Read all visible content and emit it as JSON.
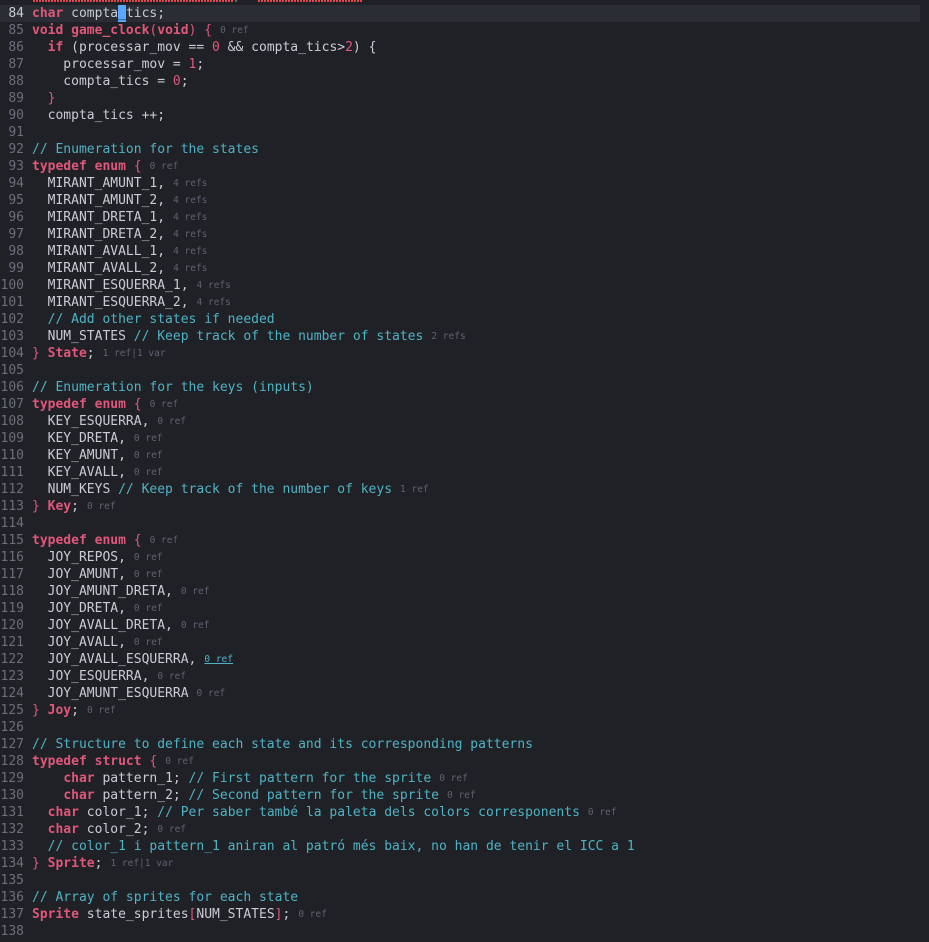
{
  "editor": {
    "lines": [
      {
        "n": "84",
        "tokens": [
          [
            "kw",
            "char"
          ],
          [
            "id",
            " compta"
          ],
          [
            "cur",
            "_"
          ],
          [
            "id",
            "tics"
          ],
          [
            "pn",
            ";"
          ]
        ]
      },
      {
        "n": "85",
        "tokens": [
          [
            "kw",
            "void"
          ],
          [
            "id",
            " "
          ],
          [
            "fn",
            "game_clock"
          ],
          [
            "br",
            "("
          ],
          [
            "kw",
            "void"
          ],
          [
            "br",
            ")"
          ],
          [
            "pn",
            " "
          ],
          [
            "br",
            "{"
          ]
        ],
        "hint": "0 ref"
      },
      {
        "n": "86",
        "tokens": [
          [
            "id",
            "  "
          ],
          [
            "kw",
            "if"
          ],
          [
            "pn",
            " ("
          ],
          [
            "id",
            "processar_mov"
          ],
          [
            "pn",
            " == "
          ],
          [
            "num",
            "0"
          ],
          [
            "pn",
            " && "
          ],
          [
            "id",
            "compta_tics"
          ],
          [
            "pn",
            ">"
          ],
          [
            "num",
            "2"
          ],
          [
            "pn",
            ") {"
          ]
        ]
      },
      {
        "n": "87",
        "tokens": [
          [
            "id",
            "    processar_mov = "
          ],
          [
            "num",
            "1"
          ],
          [
            "pn",
            ";"
          ]
        ]
      },
      {
        "n": "88",
        "tokens": [
          [
            "id",
            "    compta_tics = "
          ],
          [
            "num",
            "0"
          ],
          [
            "pn",
            ";"
          ]
        ]
      },
      {
        "n": "89",
        "tokens": [
          [
            "id",
            "  "
          ],
          [
            "br",
            "}"
          ]
        ]
      },
      {
        "n": "90",
        "tokens": [
          [
            "id",
            "  compta_tics ++;"
          ]
        ]
      },
      {
        "n": "91",
        "tokens": []
      },
      {
        "n": "92",
        "tokens": [
          [
            "cm",
            "// Enumeration for the states"
          ]
        ]
      },
      {
        "n": "93",
        "tokens": [
          [
            "kw",
            "typedef"
          ],
          [
            "id",
            " "
          ],
          [
            "kw",
            "enum"
          ],
          [
            "id",
            " "
          ],
          [
            "br",
            "{"
          ]
        ],
        "hint": "0 ref"
      },
      {
        "n": "94",
        "tokens": [
          [
            "id",
            "  MIRANT_AMUNT_1,"
          ]
        ],
        "hint": "4 refs"
      },
      {
        "n": "95",
        "tokens": [
          [
            "id",
            "  MIRANT_AMUNT_2,"
          ]
        ],
        "hint": "4 refs"
      },
      {
        "n": "96",
        "tokens": [
          [
            "id",
            "  MIRANT_DRETA_1,"
          ]
        ],
        "hint": "4 refs"
      },
      {
        "n": "97",
        "tokens": [
          [
            "id",
            "  MIRANT_DRETA_2,"
          ]
        ],
        "hint": "4 refs"
      },
      {
        "n": "98",
        "tokens": [
          [
            "id",
            "  MIRANT_AVALL_1,"
          ]
        ],
        "hint": "4 refs"
      },
      {
        "n": "99",
        "tokens": [
          [
            "id",
            "  MIRANT_AVALL_2,"
          ]
        ],
        "hint": "4 refs"
      },
      {
        "n": "100",
        "tokens": [
          [
            "id",
            "  MIRANT_ESQUERRA_1,"
          ]
        ],
        "hint": "4 refs"
      },
      {
        "n": "101",
        "tokens": [
          [
            "id",
            "  MIRANT_ESQUERRA_2,"
          ]
        ],
        "hint": "4 refs"
      },
      {
        "n": "102",
        "tokens": [
          [
            "id",
            "  "
          ],
          [
            "cm",
            "// Add other states if needed"
          ]
        ]
      },
      {
        "n": "103",
        "tokens": [
          [
            "id",
            "  NUM_STATES "
          ],
          [
            "cm",
            "// Keep track of the number of states"
          ]
        ],
        "hint": "2 refs"
      },
      {
        "n": "104",
        "tokens": [
          [
            "br",
            "}"
          ],
          [
            "id",
            " "
          ],
          [
            "ty",
            "State"
          ],
          [
            "pn",
            ";"
          ]
        ],
        "hint": "1 ref|1 var"
      },
      {
        "n": "105",
        "tokens": []
      },
      {
        "n": "106",
        "tokens": [
          [
            "cm",
            "// Enumeration for the keys (inputs)"
          ]
        ]
      },
      {
        "n": "107",
        "tokens": [
          [
            "kw",
            "typedef"
          ],
          [
            "id",
            " "
          ],
          [
            "kw",
            "enum"
          ],
          [
            "id",
            " "
          ],
          [
            "br",
            "{"
          ]
        ],
        "hint": "0 ref"
      },
      {
        "n": "108",
        "tokens": [
          [
            "id",
            "  KEY_ESQUERRA,"
          ]
        ],
        "hint": "0 ref"
      },
      {
        "n": "109",
        "tokens": [
          [
            "id",
            "  KEY_DRETA,"
          ]
        ],
        "hint": "0 ref"
      },
      {
        "n": "110",
        "tokens": [
          [
            "id",
            "  KEY_AMUNT,"
          ]
        ],
        "hint": "0 ref"
      },
      {
        "n": "111",
        "tokens": [
          [
            "id",
            "  KEY_AVALL,"
          ]
        ],
        "hint": "0 ref"
      },
      {
        "n": "112",
        "tokens": [
          [
            "id",
            "  NUM_KEYS "
          ],
          [
            "cm",
            "// Keep track of the number of keys"
          ]
        ],
        "hint": "1 ref"
      },
      {
        "n": "113",
        "tokens": [
          [
            "br",
            "}"
          ],
          [
            "id",
            " "
          ],
          [
            "ty",
            "Key"
          ],
          [
            "pn",
            ";"
          ]
        ],
        "hint": "0 ref"
      },
      {
        "n": "114",
        "tokens": []
      },
      {
        "n": "115",
        "tokens": [
          [
            "kw",
            "typedef"
          ],
          [
            "id",
            " "
          ],
          [
            "kw",
            "enum"
          ],
          [
            "id",
            " "
          ],
          [
            "br",
            "{"
          ]
        ],
        "hint": "0 ref"
      },
      {
        "n": "116",
        "tokens": [
          [
            "id",
            "  JOY_REPOS,"
          ]
        ],
        "hint": "0 ref"
      },
      {
        "n": "117",
        "tokens": [
          [
            "id",
            "  JOY_AMUNT,"
          ]
        ],
        "hint": "0 ref"
      },
      {
        "n": "118",
        "tokens": [
          [
            "id",
            "  JOY_AMUNT_DRETA,"
          ]
        ],
        "hint": "0 ref"
      },
      {
        "n": "119",
        "tokens": [
          [
            "id",
            "  JOY_DRETA,"
          ]
        ],
        "hint": "0 ref"
      },
      {
        "n": "120",
        "tokens": [
          [
            "id",
            "  JOY_AVALL_DRETA,"
          ]
        ],
        "hint": "0 ref"
      },
      {
        "n": "121",
        "tokens": [
          [
            "id",
            "  JOY_AVALL,"
          ]
        ],
        "hint": "0 ref"
      },
      {
        "n": "122",
        "tokens": [
          [
            "id",
            "  JOY_AVALL_ESQUERRA,"
          ]
        ],
        "hint": "0 ref",
        "hint_link": true
      },
      {
        "n": "123",
        "tokens": [
          [
            "id",
            "  JOY_ESQUERRA,"
          ]
        ],
        "hint": "0 ref"
      },
      {
        "n": "124",
        "tokens": [
          [
            "id",
            "  JOY_AMUNT_ESQUERRA"
          ]
        ],
        "hint": "0 ref"
      },
      {
        "n": "125",
        "tokens": [
          [
            "br",
            "}"
          ],
          [
            "id",
            " "
          ],
          [
            "ty",
            "Joy"
          ],
          [
            "pn",
            ";"
          ]
        ],
        "hint": "0 ref"
      },
      {
        "n": "126",
        "tokens": []
      },
      {
        "n": "127",
        "tokens": [
          [
            "cm",
            "// Structure to define each state and its corresponding patterns"
          ]
        ]
      },
      {
        "n": "128",
        "tokens": [
          [
            "kw",
            "typedef"
          ],
          [
            "id",
            " "
          ],
          [
            "kw",
            "struct"
          ],
          [
            "id",
            " "
          ],
          [
            "br",
            "{"
          ]
        ],
        "hint": "0 ref"
      },
      {
        "n": "129",
        "tokens": [
          [
            "id",
            "    "
          ],
          [
            "kw",
            "char"
          ],
          [
            "id",
            " pattern_1; "
          ],
          [
            "cm",
            "// First pattern for the sprite"
          ]
        ],
        "hint": "0 ref"
      },
      {
        "n": "130",
        "tokens": [
          [
            "id",
            "    "
          ],
          [
            "kw",
            "char"
          ],
          [
            "id",
            " pattern_2; "
          ],
          [
            "cm",
            "// Second pattern for the sprite"
          ]
        ],
        "hint": "0 ref"
      },
      {
        "n": "131",
        "tokens": [
          [
            "id",
            "  "
          ],
          [
            "kw",
            "char"
          ],
          [
            "id",
            " color_1; "
          ],
          [
            "cm",
            "// Per saber també la paleta dels colors corresponents"
          ]
        ],
        "hint": "0 ref"
      },
      {
        "n": "132",
        "tokens": [
          [
            "id",
            "  "
          ],
          [
            "kw",
            "char"
          ],
          [
            "id",
            " color_2;"
          ]
        ],
        "hint": "0 ref"
      },
      {
        "n": "133",
        "tokens": [
          [
            "id",
            "  "
          ],
          [
            "cm",
            "// color_1 i pattern_1 aniran al patró més baix, no han de tenir el ICC a 1"
          ]
        ]
      },
      {
        "n": "134",
        "tokens": [
          [
            "br",
            "}"
          ],
          [
            "id",
            " "
          ],
          [
            "ty",
            "Sprite"
          ],
          [
            "pn",
            ";"
          ]
        ],
        "hint": "1 ref|1 var"
      },
      {
        "n": "135",
        "tokens": []
      },
      {
        "n": "136",
        "tokens": [
          [
            "cm",
            "// Array of sprites for each state"
          ]
        ]
      },
      {
        "n": "137",
        "tokens": [
          [
            "ty",
            "Sprite"
          ],
          [
            "id",
            " state_sprites"
          ],
          [
            "br",
            "["
          ],
          [
            "id",
            "NUM_STATES"
          ],
          [
            "br",
            "]"
          ],
          [
            "pn",
            ";"
          ]
        ],
        "hint": "0 ref"
      },
      {
        "n": "138",
        "tokens": []
      }
    ]
  },
  "colors": {
    "background": "#1f2126",
    "keyword": "#e0577a",
    "comment": "#4fb3c4",
    "text": "#c9ccd3",
    "line_number": "#6a6f7a",
    "inlay_hint": "#5d6270",
    "cursor": "#5aa8ff",
    "error_squiggle": "#e0474c"
  }
}
